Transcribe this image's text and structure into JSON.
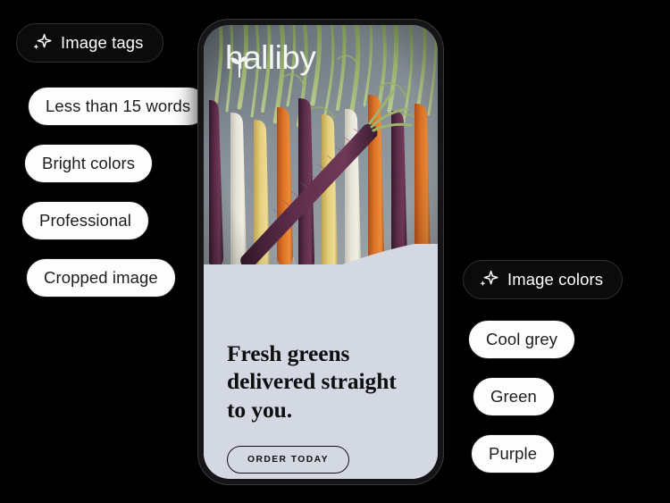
{
  "canvas": {
    "background": "#000000"
  },
  "image_tags_group": {
    "header": {
      "label": "Image tags",
      "icon": "sparkle-icon"
    },
    "items": [
      {
        "label": "Less than 15 words"
      },
      {
        "label": "Bright colors"
      },
      {
        "label": "Professional"
      },
      {
        "label": "Cropped image"
      }
    ]
  },
  "image_colors_group": {
    "header": {
      "label": "Image colors",
      "icon": "sparkle-icon"
    },
    "items": [
      {
        "label": "Cool grey"
      },
      {
        "label": "Green"
      },
      {
        "label": "Purple"
      }
    ]
  },
  "phone_preview": {
    "brand": {
      "logo_text": "halliby",
      "logo_icon": "leaf-sprout-icon"
    },
    "photo": {
      "alt_description": "heirloom carrots on grey slate",
      "palette": {
        "slate_background": "#7d8891",
        "purple_carrot": "#4e2340",
        "orange_carrot": "#d4601f",
        "yellow_carrot": "#dfc169",
        "white_carrot": "#e4e2d6",
        "green_tops": "#8fa862"
      }
    },
    "panel": {
      "background": "#d3d8e2",
      "headline": "Fresh greens delivered straight to you.",
      "cta_label": "ORDER TODAY"
    }
  },
  "theme": {
    "pill_light_bg": "#fdfdfd",
    "pill_light_text": "#1d1d1f",
    "pill_dark_bg": "#0b0b0c",
    "pill_dark_text": "#ffffff",
    "panel_bg": "#d3d8e2",
    "ink": "#111114"
  }
}
